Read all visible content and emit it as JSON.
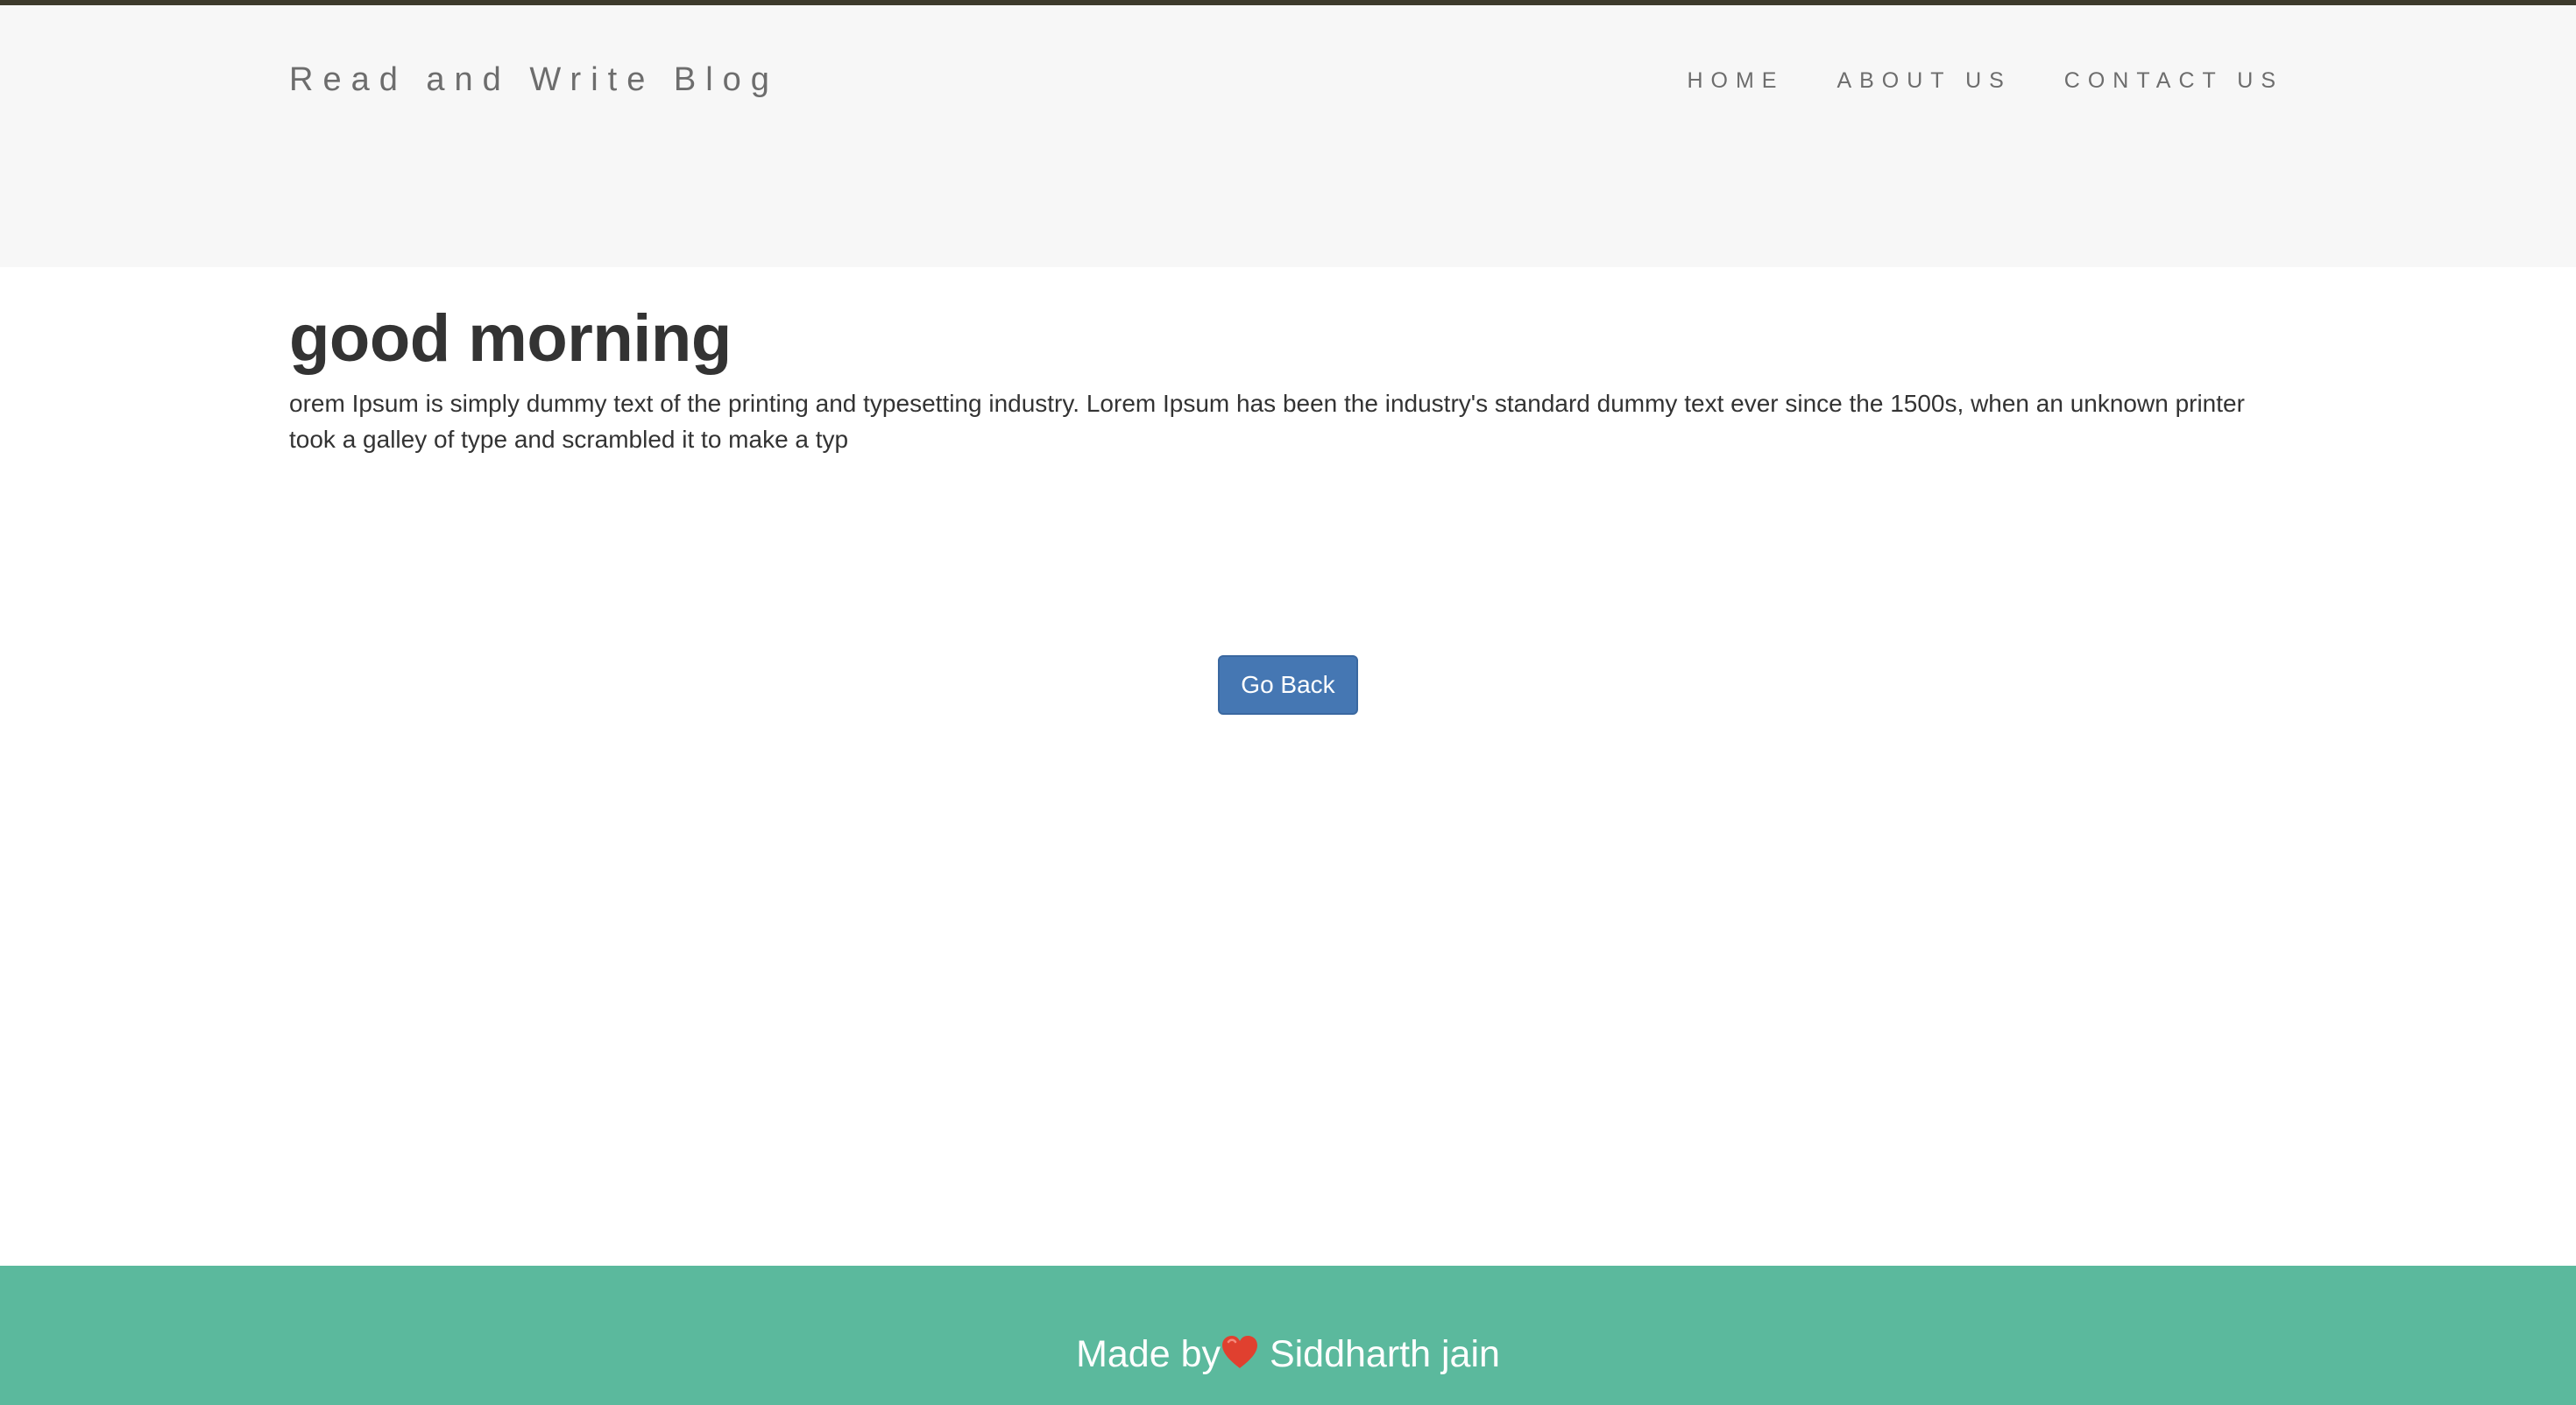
{
  "header": {
    "brand": "Read and Write Blog",
    "nav": [
      {
        "label": "HOME"
      },
      {
        "label": "ABOUT US"
      },
      {
        "label": "CONTACT US"
      }
    ]
  },
  "post": {
    "title": "good morning",
    "body": "orem Ipsum is simply dummy text of the printing and typesetting industry. Lorem Ipsum has been the industry's standard dummy text ever since the 1500s, when an unknown printer took a galley of type and scrambled it to make a typ"
  },
  "actions": {
    "go_back_label": "Go Back"
  },
  "footer": {
    "made_by": "Made by",
    "author": "Siddharth jain",
    "icon": "heart-icon"
  },
  "colors": {
    "navbar_bg": "#f7f7f7",
    "button_bg": "#4577b3",
    "footer_bg": "#5bb99d",
    "heart": "#e0402f"
  }
}
